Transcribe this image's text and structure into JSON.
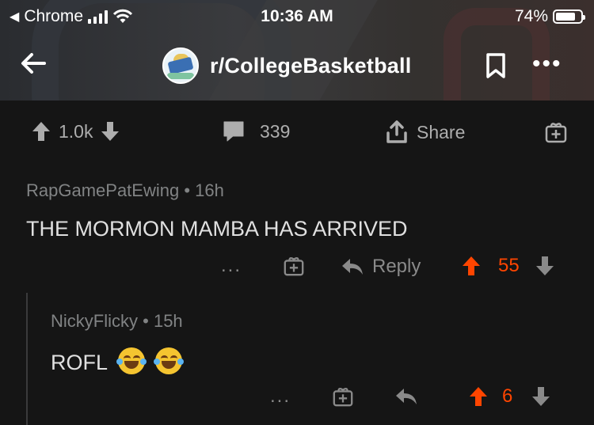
{
  "status_bar": {
    "carrier": "Chrome",
    "time": "10:36 AM",
    "battery": "74%"
  },
  "header": {
    "subreddit": "r/CollegeBasketball"
  },
  "post_actions": {
    "votes": "1.0k",
    "comments": "339",
    "share": "Share"
  },
  "comments": [
    {
      "author": "RapGamePatEwing",
      "age": "16h",
      "text": "THE MORMON MAMBA HAS ARRIVED",
      "reply_label": "Reply",
      "score": "55",
      "more": "..."
    },
    {
      "author": "NickyFlicky",
      "age": "15h",
      "text": "ROFL",
      "emoji": [
        "face-with-tears-of-joy",
        "face-with-tears-of-joy"
      ],
      "score": "6",
      "more": "..."
    }
  ],
  "colors": {
    "background": "#151515",
    "upvote_active": "#ff4500",
    "meta_text": "#818384"
  }
}
